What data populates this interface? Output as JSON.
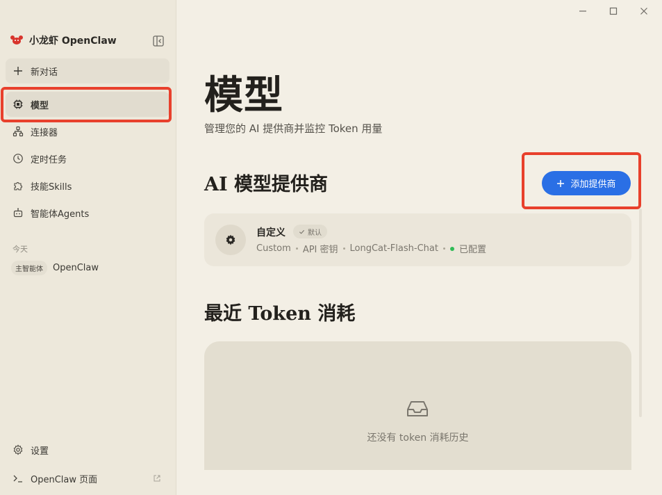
{
  "window": {
    "controls": [
      "minimize",
      "maximize",
      "close"
    ]
  },
  "sidebar": {
    "brand": "小龙虾 OpenClaw",
    "new_chat": "新对话",
    "items": [
      {
        "label": "模型",
        "icon": "cpu-icon",
        "active": true
      },
      {
        "label": "连接器",
        "icon": "network-icon"
      },
      {
        "label": "定时任务",
        "icon": "clock-icon"
      },
      {
        "label": "技能Skills",
        "icon": "puzzle-icon"
      },
      {
        "label": "智能体Agents",
        "icon": "robot-icon"
      }
    ],
    "section_today": "今天",
    "session": {
      "tag": "主智能体",
      "name": "OpenClaw"
    },
    "settings": "设置",
    "openclaw_page": "OpenClaw 页面"
  },
  "main": {
    "title": "模型",
    "subtitle": "管理您的 AI 提供商并监控 Token 用量",
    "providers_title": "AI 模型提供商",
    "add_provider_button": "添加提供商",
    "provider": {
      "name": "自定义",
      "badge": "默认",
      "type": "Custom",
      "auth": "API 密钥",
      "model": "LongCat-Flash-Chat",
      "status": "已配置"
    },
    "usage_title": "最近 Token 消耗",
    "usage_empty": "还没有 token 消耗历史"
  },
  "colors": {
    "accent": "#2a6fe5",
    "highlight": "#e8402c",
    "status_ok": "#2fbb56"
  }
}
